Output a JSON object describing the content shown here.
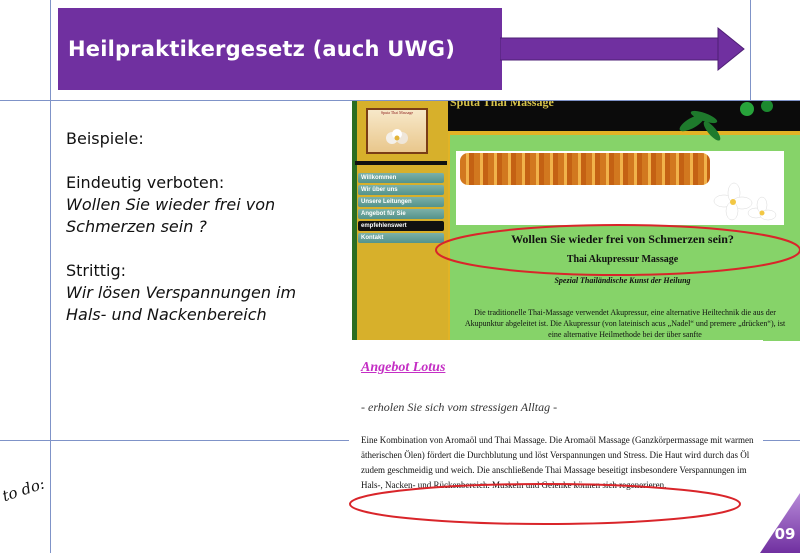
{
  "slide": {
    "title": "Heilpraktikergesetz (auch UWG)",
    "page_number": "09",
    "todo_label": "to do:",
    "accent_color": "#7030a0"
  },
  "body": {
    "intro": "Beispiele:",
    "forbidden_label": "Eindeutig verboten:",
    "forbidden_line1": "Wollen Sie wieder frei von",
    "forbidden_line2": "Schmerzen sein ?",
    "disputed_label": "Strittig:",
    "disputed_line1": "Wir lösen Verspannungen im",
    "disputed_line2": "Hals- und Nackenbereich"
  },
  "website1": {
    "header_text": "Sputa Thai Massage",
    "logo_text": "Sputa Thai Massage",
    "nav_items": [
      "Willkommen",
      "Wir über uns",
      "Unsere Leitungen",
      "Angebot für Sie",
      "empfehlenswert",
      "Kontakt"
    ],
    "headline": "Wollen Sie wieder frei von Schmerzen sein?",
    "subheadline": "Thai Akupressur Massage",
    "tagline": "Spezial Thailändische Kunst der Heilung",
    "paragraph": "Die traditionelle Thai-Massage verwendet Akupressur, eine alternative Heiltechnik die aus der Akupunktur abgeleitet ist. Die Akupressur (von lateinisch acus „Nadel“ und premere „drücken“), ist eine alternative Heilmethode bei der über sanfte"
  },
  "website2": {
    "title": "Angebot Lotus",
    "subtitle": "- erholen Sie sich vom stressigen Alltag -",
    "text": "Eine Kombination von Aromaöl und Thai Massage. Die Aromaöl Massage (Ganzkörpermassage mit warmen ätherischen Ölen) fördert die Durchblutung und löst Verspannungen und Stress. Die Haut wird durch das Öl zudem geschmeidig und weich. Die anschließende Thai Massage beseitigt insbesondere Verspannungen im Hals-, Nacken- und Rückenbereich. Muskeln und Gelenke können sich regenerieren."
  }
}
